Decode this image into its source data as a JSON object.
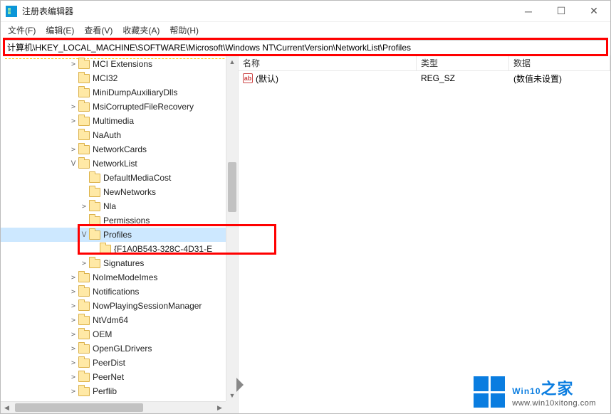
{
  "window": {
    "title": "注册表编辑器"
  },
  "menu": {
    "file": "文件(F)",
    "edit": "编辑(E)",
    "view": "查看(V)",
    "favorites": "收藏夹(A)",
    "help": "帮助(H)"
  },
  "address": {
    "value": "计算机\\HKEY_LOCAL_MACHINE\\SOFTWARE\\Microsoft\\Windows NT\\CurrentVersion\\NetworkList\\Profiles"
  },
  "tree": {
    "items": [
      {
        "indent": 5,
        "tw": ">",
        "label": "MCI Extensions"
      },
      {
        "indent": 5,
        "tw": "",
        "label": "MCI32"
      },
      {
        "indent": 5,
        "tw": "",
        "label": "MiniDumpAuxiliaryDlls"
      },
      {
        "indent": 5,
        "tw": ">",
        "label": "MsiCorruptedFileRecovery"
      },
      {
        "indent": 5,
        "tw": ">",
        "label": "Multimedia"
      },
      {
        "indent": 5,
        "tw": "",
        "label": "NaAuth"
      },
      {
        "indent": 5,
        "tw": ">",
        "label": "NetworkCards"
      },
      {
        "indent": 5,
        "tw": "v",
        "label": "NetworkList"
      },
      {
        "indent": 6,
        "tw": "",
        "label": "DefaultMediaCost"
      },
      {
        "indent": 6,
        "tw": "",
        "label": "NewNetworks"
      },
      {
        "indent": 6,
        "tw": ">",
        "label": "Nla"
      },
      {
        "indent": 6,
        "tw": "",
        "label": "Permissions"
      },
      {
        "indent": 6,
        "tw": "v",
        "label": "Profiles",
        "sel": true
      },
      {
        "indent": 7,
        "tw": "",
        "label": "{F1A0B543-328C-4D31-E"
      },
      {
        "indent": 6,
        "tw": ">",
        "label": "Signatures"
      },
      {
        "indent": 5,
        "tw": ">",
        "label": "NoImeModeImes"
      },
      {
        "indent": 5,
        "tw": ">",
        "label": "Notifications"
      },
      {
        "indent": 5,
        "tw": ">",
        "label": "NowPlayingSessionManager"
      },
      {
        "indent": 5,
        "tw": ">",
        "label": "NtVdm64"
      },
      {
        "indent": 5,
        "tw": ">",
        "label": "OEM"
      },
      {
        "indent": 5,
        "tw": ">",
        "label": "OpenGLDrivers"
      },
      {
        "indent": 5,
        "tw": ">",
        "label": "PeerDist"
      },
      {
        "indent": 5,
        "tw": ">",
        "label": "PeerNet"
      },
      {
        "indent": 5,
        "tw": ">",
        "label": "Perflib"
      }
    ]
  },
  "list": {
    "headers": {
      "name": "名称",
      "type": "类型",
      "data": "数据"
    },
    "rows": [
      {
        "name": "(默认)",
        "type": "REG_SZ",
        "data": "(数值未设置)"
      }
    ]
  },
  "brand": {
    "name": "Win10",
    "suffix": "之家",
    "url": "www.win10xitong.com"
  }
}
